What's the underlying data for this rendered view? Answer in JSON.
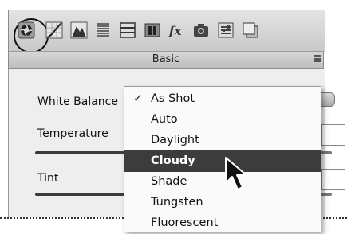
{
  "toolbar": {
    "tools": [
      {
        "icon": "basic-aperture-icon",
        "selected": true
      },
      {
        "icon": "tone-curve-icon"
      },
      {
        "icon": "hsl-mountains-icon"
      },
      {
        "icon": "split-toning-icon"
      },
      {
        "icon": "detail-icon"
      },
      {
        "icon": "lens-corrections-icon"
      },
      {
        "icon": "fx-effects-icon"
      },
      {
        "icon": "camera-calibration-icon"
      },
      {
        "icon": "presets-icon"
      },
      {
        "icon": "snapshots-icon"
      }
    ]
  },
  "panel": {
    "title": "Basic",
    "white_balance_label": "White Balance",
    "temperature_label": "Temperature",
    "tint_label": "Tint"
  },
  "white_balance_menu": {
    "selected": "As Shot",
    "highlighted": "Cloudy",
    "options": [
      "As Shot",
      "Auto",
      "Daylight",
      "Cloudy",
      "Shade",
      "Tungsten",
      "Fluorescent"
    ]
  }
}
